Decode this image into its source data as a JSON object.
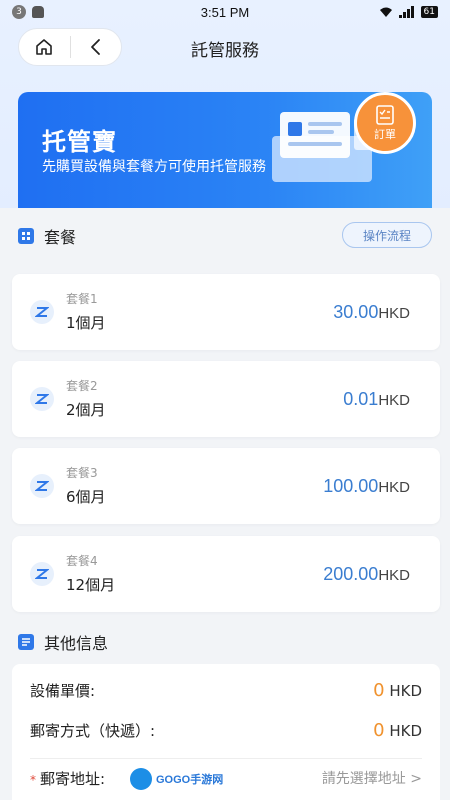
{
  "status_bar": {
    "notification_count": "3",
    "time": "3:51 PM",
    "battery": "61",
    "icons": [
      "android-icon",
      "wifi-icon",
      "signal-icon",
      "battery-icon"
    ]
  },
  "header": {
    "title": "託管服務",
    "home_icon": "home-icon",
    "back_icon": "chevron-left-icon"
  },
  "banner": {
    "title": "托管寶",
    "subtitle": "先購買設備與套餐方可使用托管服務",
    "order_label": "訂單"
  },
  "plans_section": {
    "title": "套餐",
    "flow_button": "操作流程",
    "plans": [
      {
        "name": "套餐1",
        "duration": "1個月",
        "price": "30.00",
        "currency": "HKD"
      },
      {
        "name": "套餐2",
        "duration": "2個月",
        "price": "0.01",
        "currency": "HKD"
      },
      {
        "name": "套餐3",
        "duration": "6個月",
        "price": "100.00",
        "currency": "HKD"
      },
      {
        "name": "套餐4",
        "duration": "12個月",
        "price": "200.00",
        "currency": "HKD"
      }
    ]
  },
  "other_section": {
    "title": "其他信息",
    "unit_price_label": "設備單價:",
    "unit_price_value": "0",
    "unit_price_currency": "HKD",
    "shipping_label": "郵寄方式（快遞）:",
    "shipping_value": "0",
    "shipping_currency": "HKD",
    "required_mark": "*",
    "address_label": "郵寄地址:",
    "address_placeholder": "請先選擇地址 >",
    "watermark_text": "GOGO手游网"
  },
  "colors": {
    "accent": "#2f78e8",
    "price_blue": "#3a7dd0",
    "orange": "#f0922e",
    "banner_start": "#1f6ff2",
    "banner_end": "#3fa0f7"
  }
}
